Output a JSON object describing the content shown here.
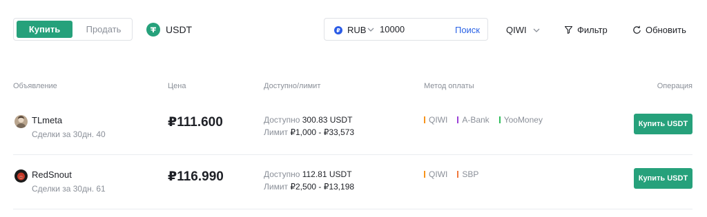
{
  "toolbar": {
    "buy_label": "Купить",
    "sell_label": "Продать",
    "asset": "USDT",
    "currency": "RUB",
    "amount": "10000",
    "search_label": "Поиск",
    "payment_method": "QIWI",
    "filter_label": "Фильтр",
    "refresh_label": "Обновить"
  },
  "colors": {
    "accent": "#26a17b",
    "link": "#2b63e6"
  },
  "table": {
    "headers": {
      "ad": "Объявление",
      "price": "Цена",
      "available": "Доступно/лимит",
      "method": "Метод оплаты",
      "operation": "Операция"
    },
    "rows": [
      {
        "user": "TLmeta",
        "trades": "Сделки за 30дн. 40",
        "price": "₽111.600",
        "available_label": "Доступно",
        "available_value": "300.83 USDT",
        "limit_label": "Лимит",
        "limit_value": "₽1,000 - ₽33,573",
        "methods": [
          {
            "name": "QIWI",
            "color": "#f7931a"
          },
          {
            "name": "A-Bank",
            "color": "#9b3fd6"
          },
          {
            "name": "YooMoney",
            "color": "#2ebd5a"
          }
        ],
        "button": "Купить USDT"
      },
      {
        "user": "RedSnout",
        "trades": "Сделки за 30дн. 61",
        "price": "₽116.990",
        "available_label": "Доступно",
        "available_value": "112.81 USDT",
        "limit_label": "Лимит",
        "limit_value": "₽2,500 - ₽13,198",
        "methods": [
          {
            "name": "QIWI",
            "color": "#f7931a"
          },
          {
            "name": "SBP",
            "color": "#f0783c"
          }
        ],
        "button": "Купить USDT"
      }
    ]
  }
}
